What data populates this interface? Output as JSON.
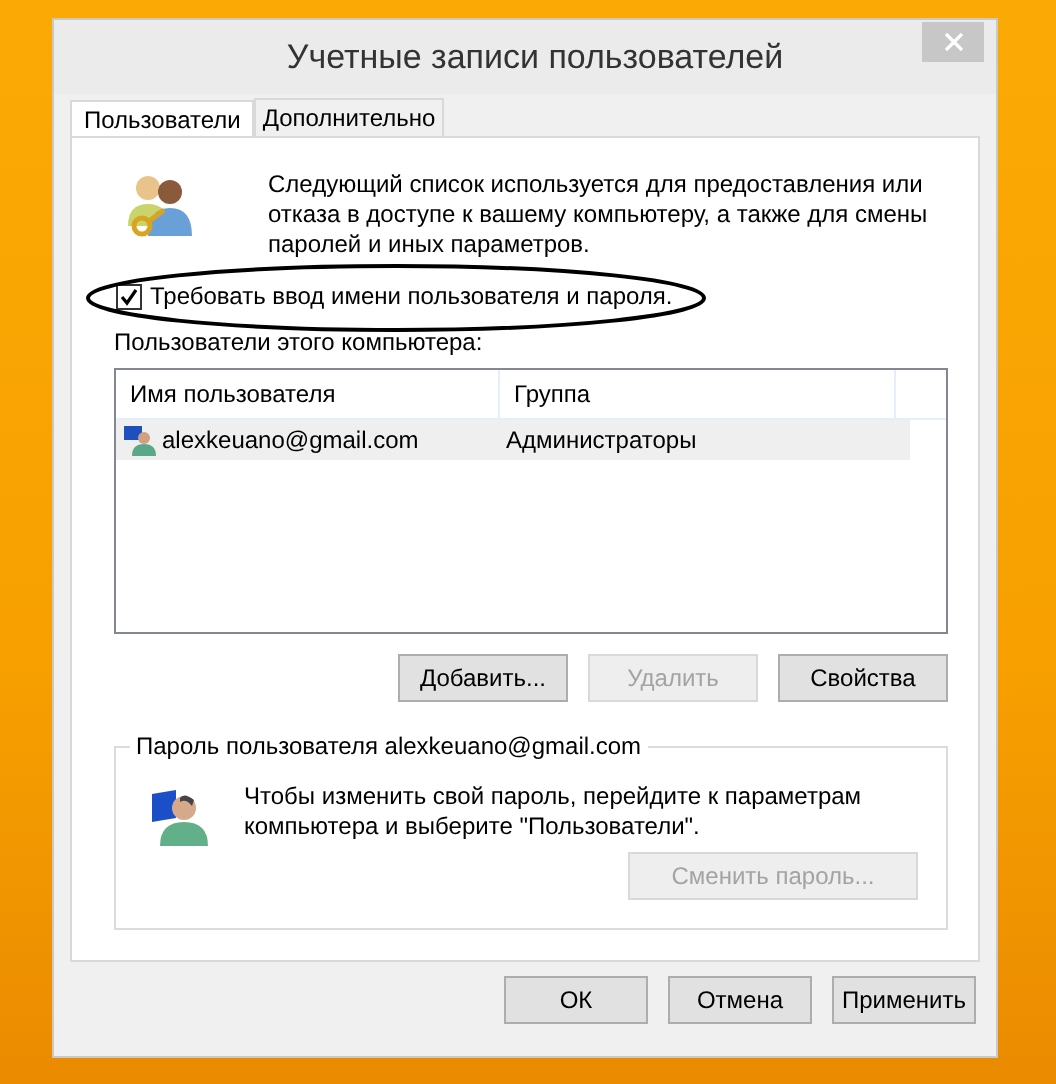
{
  "window": {
    "title": "Учетные записи пользователей"
  },
  "tabs": [
    {
      "label": "Пользователи",
      "selected": true
    },
    {
      "label": "Дополнительно",
      "selected": false
    }
  ],
  "description": "Следующий список используется для предоставления или отказа в доступе к вашему компьютеру, а также для смены паролей и иных параметров.",
  "require_password": {
    "label": "Требовать ввод имени пользователя и пароля.",
    "checked": true
  },
  "highlight": {
    "kind": "ellipse"
  },
  "users_label": "Пользователи этого компьютера:",
  "users_table": {
    "columns": [
      "Имя пользователя",
      "Группа"
    ],
    "rows": [
      {
        "cells": [
          "alexkeuano@gmail.com",
          "Администраторы"
        ],
        "selected": true
      }
    ]
  },
  "user_buttons": [
    {
      "label": "Добавить...",
      "disabled": false
    },
    {
      "label": "Удалить",
      "disabled": true
    },
    {
      "label": "Свойства",
      "disabled": false
    }
  ],
  "password_group": {
    "title": "Пароль пользователя alexkeuano@gmail.com",
    "text": "Чтобы изменить свой пароль, перейдите к параметрам компьютера и выберите \"Пользователи\".",
    "button": {
      "label": "Сменить пароль...",
      "disabled": true
    }
  },
  "dialog_buttons": [
    {
      "label": "ОК",
      "disabled": false
    },
    {
      "label": "Отмена",
      "disabled": false
    },
    {
      "label": "Применить",
      "disabled": false
    }
  ]
}
